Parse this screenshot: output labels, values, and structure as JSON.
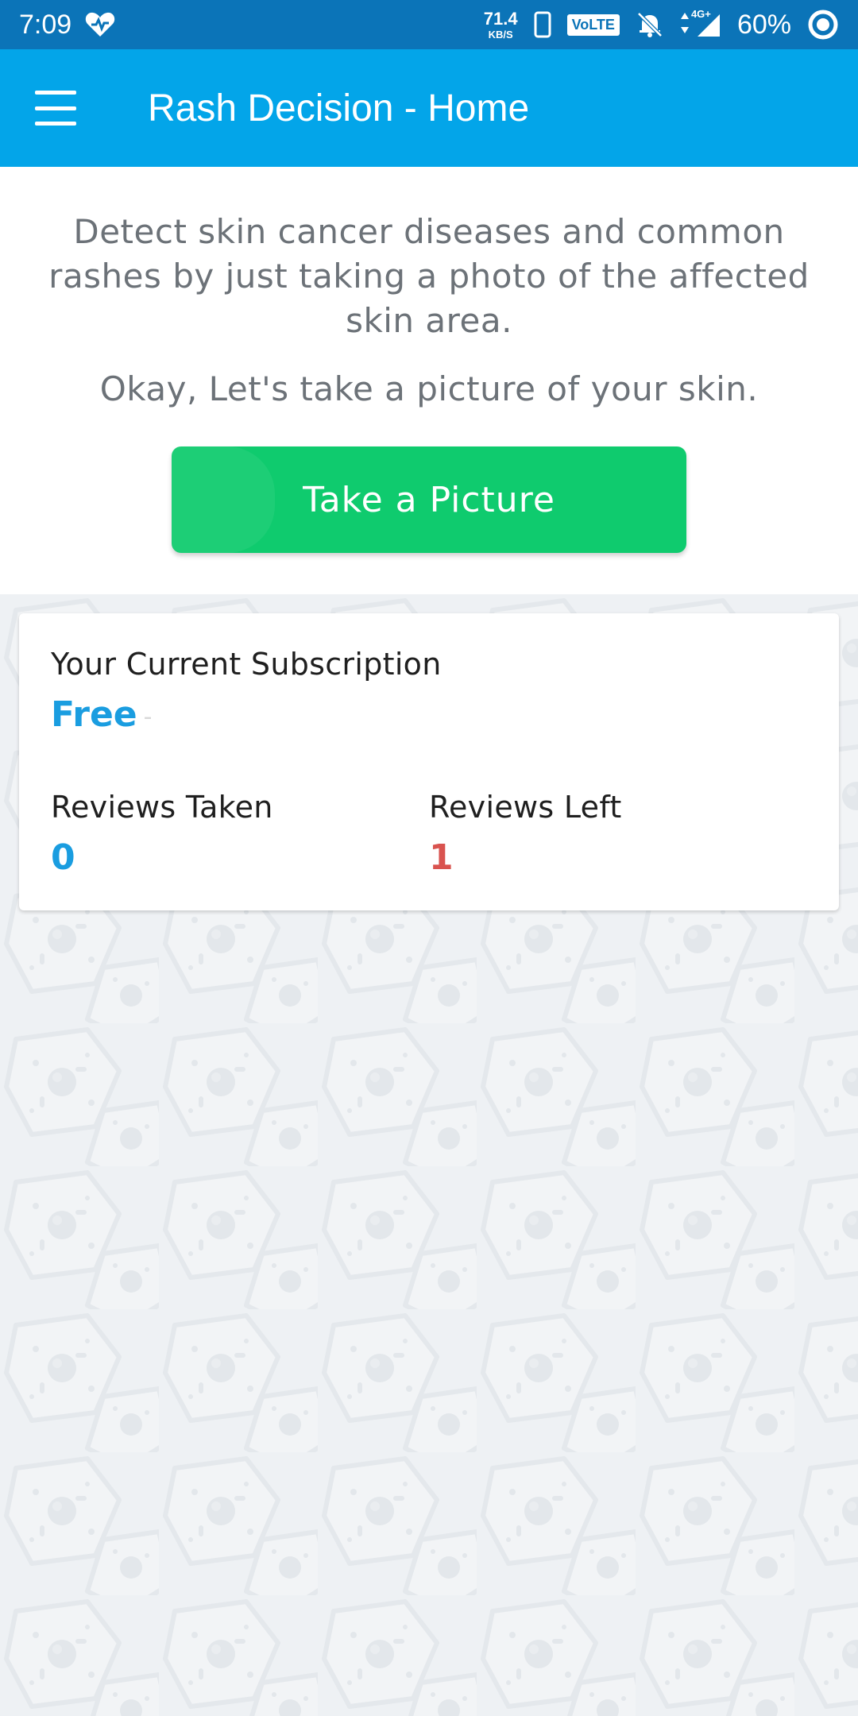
{
  "status_bar": {
    "time": "7:09",
    "net_speed_value": "71.4",
    "net_speed_unit": "KB/S",
    "volte_label": "VoLTE",
    "network_label": "4G+",
    "battery_percent": "60%"
  },
  "app_bar": {
    "title": "Rash Decision - Home"
  },
  "intro": {
    "description": "Detect skin cancer diseases and common rashes by just taking a photo of the affected skin area.",
    "prompt": "Okay, Let's take a picture of your skin.",
    "take_picture_label": "Take a Picture"
  },
  "subscription": {
    "heading": "Your Current Subscription",
    "plan": "Free",
    "plan_suffix": "-",
    "reviews_taken_label": "Reviews Taken",
    "reviews_taken_value": "0",
    "reviews_left_label": "Reviews Left",
    "reviews_left_value": "1"
  },
  "colors": {
    "status_bar": "#0b74b8",
    "app_bar": "#03a5e9",
    "primary_button": "#0fcb6e",
    "accent_blue": "#1a9de0",
    "accent_red": "#d9534f",
    "background": "#eef1f4"
  },
  "icons": {
    "menu": "hamburger-menu-icon",
    "status_heart": "heart-icon",
    "phone": "phone-icon",
    "mute": "notifications-off-icon",
    "signal": "signal-icon",
    "battery": "battery-icon"
  }
}
